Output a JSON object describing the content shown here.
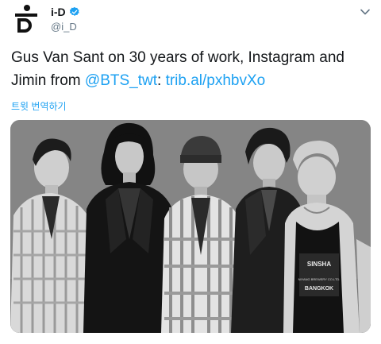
{
  "header": {
    "display_name": "i-D",
    "handle": "@i_D",
    "avatar_icon": "i-d-logo-icon",
    "verified_icon": "verified-badge-icon",
    "menu_icon": "chevron-down-icon"
  },
  "tweet": {
    "text_part1": "Gus Van Sant on 30 years of work, Instagram and Jimin from ",
    "mention": "@BTS_twt",
    "text_colon": ":",
    "link": "trib.al/pxhbvXo",
    "translate_label": "트윗 번역하기"
  },
  "photo": {
    "shirt_print_line1": "SINSHA",
    "shirt_print_line2": "NIYANG BREWERY CO.LTD.",
    "shirt_print_line3": "BANGKOK"
  },
  "colors": {
    "link": "#1da1f2",
    "verified": "#1da1f2",
    "text": "#14171a",
    "secondary": "#657786"
  }
}
